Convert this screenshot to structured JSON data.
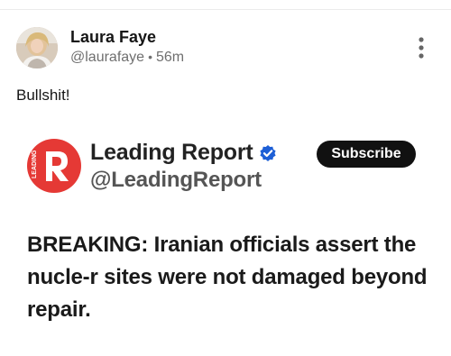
{
  "post": {
    "author": {
      "name": "Laura Faye",
      "handle": "@laurafaye",
      "separator": "•",
      "time": "56m",
      "avatar_icon": "profile-photo"
    },
    "text": "Bullshit!",
    "menu_icon": "more-vertical-icon"
  },
  "embed": {
    "account": {
      "name": "Leading Report",
      "handle": "@LeadingReport",
      "verified_icon": "verified-badge-icon",
      "logo_letter": "R",
      "logo_text": "LEADING",
      "logo_color": "#e53935"
    },
    "subscribe_label": "Subscribe",
    "body": "BREAKING: Iranian officials assert the nucle-r sites were not damaged beyond repair."
  }
}
